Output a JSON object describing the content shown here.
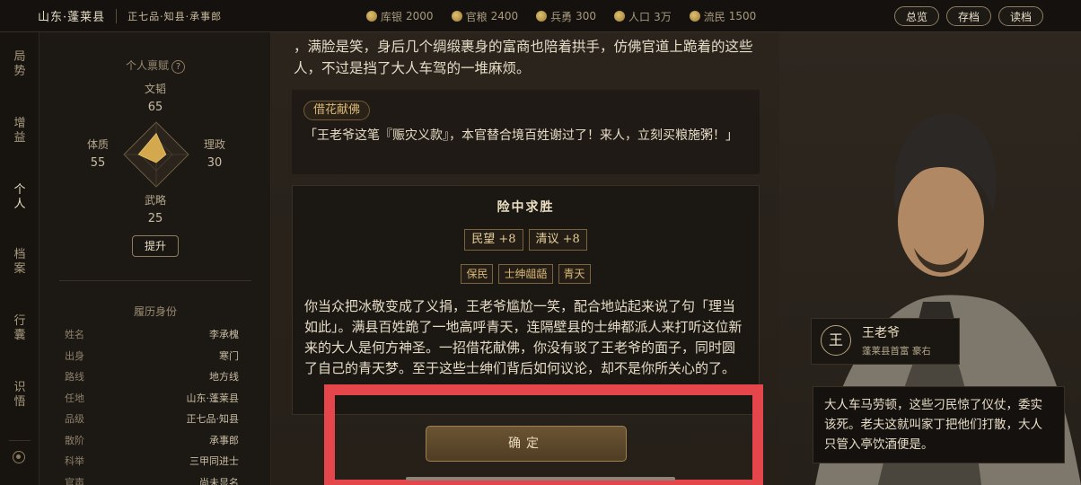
{
  "header": {
    "region": "山东·蓬莱县",
    "rank": "正七品·知县·承事郎",
    "stats": [
      {
        "label": "库银",
        "value": "2000"
      },
      {
        "label": "官粮",
        "value": "2400"
      },
      {
        "label": "兵勇",
        "value": "300"
      },
      {
        "label": "人口",
        "value": "3万"
      },
      {
        "label": "流民",
        "value": "1500"
      }
    ],
    "buttons": {
      "overview": "总览",
      "save": "存档",
      "load": "读档"
    }
  },
  "nav": {
    "items": [
      "局势",
      "增益",
      "个人",
      "档案",
      "行囊",
      "识悟"
    ],
    "active": "个人"
  },
  "talents": {
    "title": "个人禀赋",
    "help": "?",
    "wentao": {
      "label": "文韬",
      "value": "65"
    },
    "lizheng": {
      "label": "理政",
      "value": "30"
    },
    "wulue": {
      "label": "武略",
      "value": "25"
    },
    "tizhi": {
      "label": "体质",
      "value": "55"
    },
    "upgrade": "提升"
  },
  "resume": {
    "title": "履历身份",
    "rows": [
      {
        "k": "姓名",
        "v": "李承槐"
      },
      {
        "k": "出身",
        "v": "寒门"
      },
      {
        "k": "路线",
        "v": "地方线"
      },
      {
        "k": "任地",
        "v": "山东·蓬莱县"
      },
      {
        "k": "品级",
        "v": "正七品·知县"
      },
      {
        "k": "散阶",
        "v": "承事郎"
      },
      {
        "k": "科举",
        "v": "三甲同进士"
      },
      {
        "k": "官声",
        "v": "尚未显名"
      }
    ]
  },
  "story": {
    "para1": "，满脸是笑，身后几个绸缎裹身的富商也陪着拱手，仿佛官道上跪着的这些人，不过是挡了大人车驾的一堆麻烦。",
    "choice_tag": "借花献佛",
    "choice_text": "「王老爷这笔『赈灾义款』，本官替合境百姓谢过了！来人，立刻买粮施粥！」",
    "result_title": "险中求胜",
    "effects": [
      "民望 +8",
      "清议 +8"
    ],
    "tags": [
      "保民",
      "士绅龃龉",
      "青天"
    ],
    "result_text": "你当众把冰敬变成了义捐，王老爷尴尬一笑，配合地站起来说了句「理当如此」。满县百姓跪了一地高呼青天，连隔壁县的士绅都派人来打听这位新来的大人是何方神圣。一招借花献佛，你没有驳了王老爷的面子，同时圆了自己的青天梦。至于这些士绅们背后如何议论，却不是你所关心的了。",
    "confirm": "确定"
  },
  "character": {
    "seal": "王",
    "name": "王老爷",
    "desc": "蓬莱县首富  豪右",
    "speech": "大人车马劳顿，这些刁民惊了仪仗，委实该死。老夫这就叫家丁把他们打散，大人只管入亭饮酒便是。"
  },
  "colors": {
    "accent": "#d9b878",
    "highlight": "#e5464b",
    "radar": "#d4a94e"
  }
}
